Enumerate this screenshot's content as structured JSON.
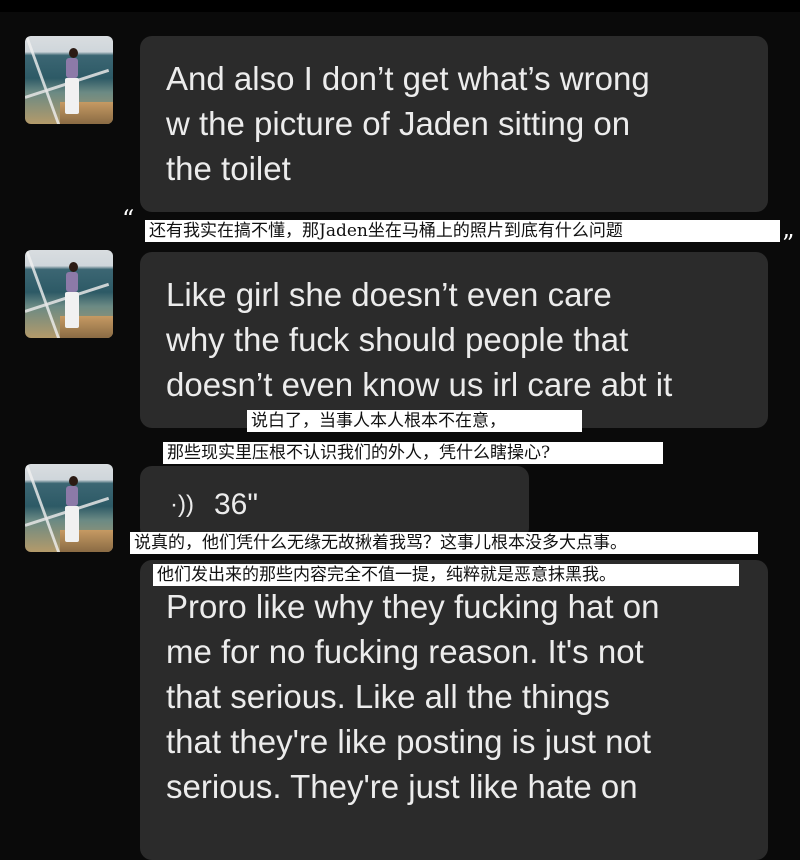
{
  "messages": [
    {
      "type": "text",
      "lines": [
        "And also I don’t get what’s wrong",
        "w the picture of Jaden sitting on",
        "the toilet"
      ]
    },
    {
      "type": "text",
      "lines": [
        "Like girl she doesn’t even care",
        "why the fuck should people that",
        "doesn’t even know us irl care abt it"
      ]
    },
    {
      "type": "voice",
      "icon": "voice-wave-icon",
      "icon_glyph": "·))",
      "duration": "36\""
    },
    {
      "type": "text",
      "lines": [
        "Proro like why they fucking hat on",
        "me for no fucking reason. It's not",
        "that serious. Like all the things",
        "that they're like posting is just not",
        "serious. They're just like hate on"
      ]
    }
  ],
  "subtitles": {
    "open_quote": "“",
    "close_quote": "”",
    "line1": "还有我实在搞不懂，那Jaden坐在马桶上的照片到底有什么问题",
    "line2": "说白了，当事人本人根本不在意，",
    "line3": "那些现实里压根不认识我们的外人，凭什么瞎操心?",
    "line4": "说真的，他们凭什么无缘无故揪着我骂？这事儿根本没多大点事。",
    "line5": "他们发出来的那些内容完全不值一提，纯粹就是恶意抹黑我。"
  },
  "colors": {
    "background": "#0a0a0a",
    "bubble": "#2b2b2b",
    "text": "#ececec",
    "caption_bg": "#ffffff"
  }
}
